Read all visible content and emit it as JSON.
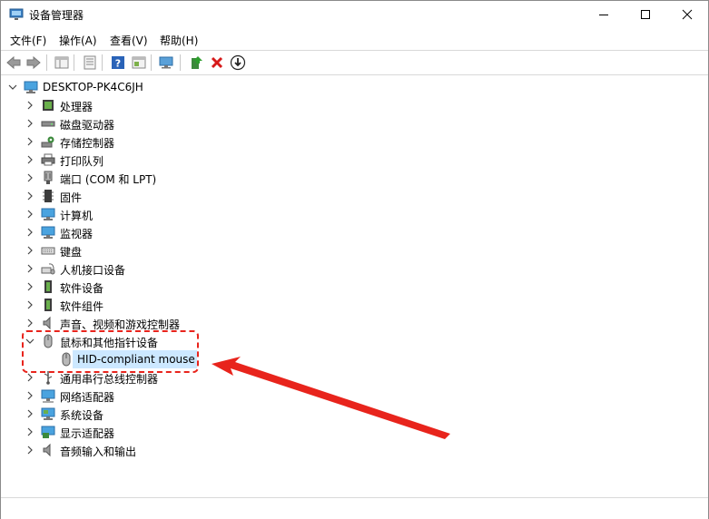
{
  "window": {
    "title": "设备管理器"
  },
  "menu": {
    "file": "文件(F)",
    "action": "操作(A)",
    "view": "查看(V)",
    "help": "帮助(H)"
  },
  "tree": {
    "root": "DESKTOP-PK4C6JH",
    "items": [
      {
        "label": "处理器",
        "icon": "processor-icon"
      },
      {
        "label": "磁盘驱动器",
        "icon": "disk-drive-icon"
      },
      {
        "label": "存储控制器",
        "icon": "storage-controller-icon"
      },
      {
        "label": "打印队列",
        "icon": "printer-icon"
      },
      {
        "label": "端口 (COM 和 LPT)",
        "icon": "port-icon"
      },
      {
        "label": "固件",
        "icon": "firmware-icon"
      },
      {
        "label": "计算机",
        "icon": "computer-icon"
      },
      {
        "label": "监视器",
        "icon": "monitor-icon"
      },
      {
        "label": "键盘",
        "icon": "keyboard-icon"
      },
      {
        "label": "人机接口设备",
        "icon": "hid-icon"
      },
      {
        "label": "软件设备",
        "icon": "software-device-icon"
      },
      {
        "label": "软件组件",
        "icon": "software-component-icon"
      },
      {
        "label": "声音、视频和游戏控制器",
        "icon": "sound-icon"
      },
      {
        "label": "鼠标和其他指针设备",
        "icon": "mouse-icon",
        "expanded": true
      },
      {
        "label": "通用串行总线控制器",
        "icon": "usb-icon"
      },
      {
        "label": "网络适配器",
        "icon": "network-adapter-icon"
      },
      {
        "label": "系统设备",
        "icon": "system-device-icon"
      },
      {
        "label": "显示适配器",
        "icon": "display-adapter-icon"
      },
      {
        "label": "音频输入和输出",
        "icon": "audio-io-icon"
      }
    ],
    "child": {
      "label": "HID-compliant mouse",
      "icon": "mouse-icon",
      "selected": true
    }
  },
  "colors": {
    "accent_selection": "#cce8ff",
    "annotation_red": "#e8241c"
  }
}
